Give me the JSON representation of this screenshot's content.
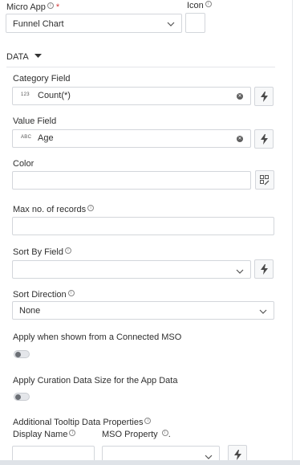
{
  "micro_app": {
    "label": "Micro App",
    "required_mark": "*",
    "selected": "Funnel Chart"
  },
  "icon": {
    "label": "Icon"
  },
  "section": {
    "label": "DATA"
  },
  "category_field": {
    "label": "Category Field",
    "type_tag": "123",
    "value": "Count(*)"
  },
  "value_field": {
    "label": "Value Field",
    "type_tag": "ABC",
    "value": "Age"
  },
  "color": {
    "label": "Color",
    "value": ""
  },
  "max_records": {
    "label": "Max no. of records",
    "value": ""
  },
  "sort_by_field": {
    "label": "Sort By Field",
    "value": ""
  },
  "sort_direction": {
    "label": "Sort Direction",
    "selected": "None"
  },
  "apply_connected": {
    "label": "Apply when shown from a Connected MSO",
    "enabled": false
  },
  "apply_curation": {
    "label": "Apply Curation Data Size for the App Data",
    "enabled": false
  },
  "tooltip": {
    "label": "Additional Tooltip Data Properties",
    "display_name_label": "Display Name",
    "mso_property_label": "MSO Property",
    "mso_property_suffix": "."
  },
  "icons": {
    "info": "info-icon",
    "dropdown": "chevron-down-icon",
    "caret": "caret-down-icon",
    "clear": "clear-icon",
    "expression": "lightning-icon",
    "color_picker": "color-picker-icon"
  }
}
